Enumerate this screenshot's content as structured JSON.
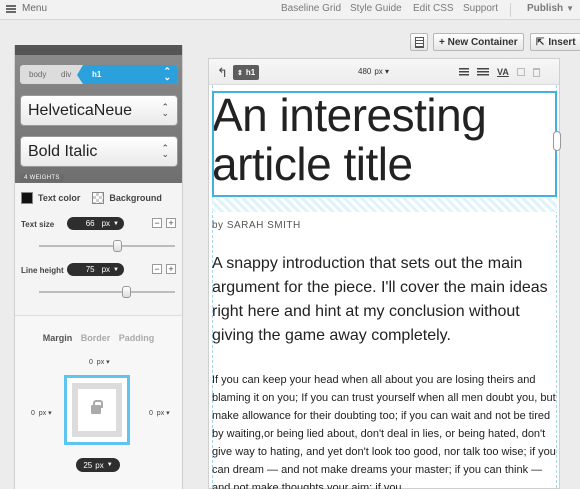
{
  "topbar": {
    "menu_label": "Menu",
    "links": [
      "Baseline Grid",
      "Style Guide",
      "Edit CSS",
      "Support"
    ],
    "publish_label": "Publish"
  },
  "toolbar": {
    "new_container_label": "+ New Container",
    "insert_label": "Insert"
  },
  "panel": {
    "breadcrumb": [
      "body",
      "div",
      "h1"
    ],
    "font_family": "HelveticaNeue",
    "font_weight": "Bold Italic",
    "weights_badge": "4 WEIGHTS",
    "text_color_label": "Text color",
    "background_label": "Background",
    "text_size_label": "Text size",
    "text_size_value": "66",
    "line_height_label": "Line height",
    "line_height_value": "75",
    "unit": "px",
    "text_size_slider": 0.58,
    "line_height_slider": 0.64,
    "box_tabs": [
      "Margin",
      "Border",
      "Padding"
    ],
    "margin_top": "0",
    "margin_left": "0",
    "margin_right": "0",
    "margin_bottom": "25"
  },
  "canvas": {
    "element_tag": "h1",
    "width_value": "480",
    "width_unit": "px",
    "va_label": "VA",
    "title": "An interesting article title",
    "byline": "by SARAH SMITH",
    "intro": "A snappy introduction that sets out the main argument for the piece. I'll cover the main ideas right here and hint at my conclusion without giving the game away completely.",
    "body": "If you can keep your head when all about you are losing theirs and blaming it on you; If you can trust yourself when all men doubt you, but make allowance for their doubting too; if you can wait and not be tired by waiting,or being lied about, don't deal in lies, or being hated, don't give way to hating, and yet don't look too good, nor talk too wise; if you can dream — and not make dreams your master; if you can think — and not make thoughts your aim; if you"
  },
  "colors": {
    "accent": "#2aa1dd",
    "selection": "#43b1e0",
    "pill": "#2e2e2e"
  }
}
